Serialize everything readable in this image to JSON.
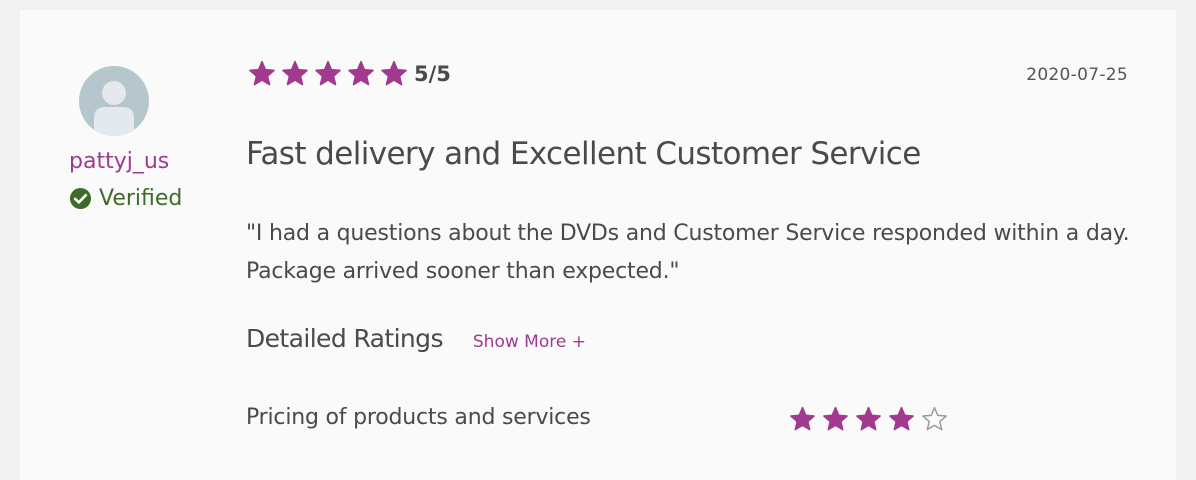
{
  "review": {
    "username": "pattyj_us",
    "verified_label": "Verified",
    "rating": 5,
    "rating_max": 5,
    "score_text": "5/5",
    "date": "2020-07-25",
    "title": "Fast delivery and Excellent Customer Service",
    "body": "\"I had a questions about the DVDs and Customer Service responded within a day. Package arrived sooner than expected.\""
  },
  "detailed": {
    "heading": "Detailed Ratings",
    "show_more_label": "Show More +",
    "items": [
      {
        "label": "Pricing of products and services",
        "rating": 4,
        "max": 5
      }
    ]
  },
  "icons": {
    "avatar": "user-avatar-icon",
    "verified": "check-circle-icon",
    "star": "star-icon"
  },
  "colors": {
    "accent": "#a0398f",
    "verified": "#3f6b2a",
    "star_filled": "#a0398f",
    "star_empty": "#9a9a9a",
    "avatar_bg": "#b6c6cd",
    "card_bg": "#fafafa",
    "page_bg": "#f2f2f2",
    "text": "#4a4a4a"
  }
}
